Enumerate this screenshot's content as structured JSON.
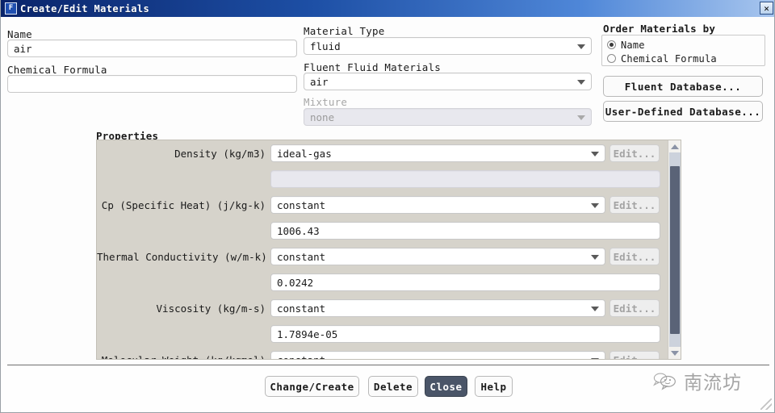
{
  "window": {
    "title": "Create/Edit Materials",
    "icon": "fluent-f-icon",
    "icon_letter": "F",
    "close_glyph": "✕"
  },
  "left": {
    "name_label": "Name",
    "name_value": "air",
    "chemical_formula_label": "Chemical Formula",
    "chemical_formula_value": ""
  },
  "middle": {
    "material_type_label": "Material Type",
    "material_type_value": "fluid",
    "fluent_fluid_materials_label": "Fluent Fluid Materials",
    "fluent_fluid_materials_value": "air",
    "mixture_label": "Mixture",
    "mixture_value": "none"
  },
  "right": {
    "order_label": "Order Materials by",
    "radio_name": "Name",
    "radio_chemical_formula": "Chemical Formula",
    "fluent_database_button": "Fluent Database...",
    "user_defined_database_button": "User-Defined Database..."
  },
  "properties": {
    "label": "Properties",
    "edit_label": "Edit...",
    "rows": [
      {
        "label": "Density (kg/m3)",
        "method": "ideal-gas",
        "value": "",
        "value_disabled": true
      },
      {
        "label": "Cp (Specific Heat) (j/kg-k)",
        "method": "constant",
        "value": "1006.43",
        "value_disabled": false
      },
      {
        "label": "Thermal Conductivity (w/m-k)",
        "method": "constant",
        "value": "0.0242",
        "value_disabled": false
      },
      {
        "label": "Viscosity (kg/m-s)",
        "method": "constant",
        "value": "1.7894e-05",
        "value_disabled": false
      },
      {
        "label": "Molecular Weight (kg/kgmol)",
        "method": "constant",
        "value": "",
        "value_disabled": false
      }
    ]
  },
  "footer": {
    "change_create": "Change/Create",
    "delete": "Delete",
    "close": "Close",
    "help": "Help"
  },
  "watermark": {
    "text": "南流坊",
    "icon": "chat-bubbles-icon"
  },
  "colors": {
    "titlebar_start": "#0a246a",
    "titlebar_end": "#a8c6ee",
    "properties_panel": "#d6d3cb",
    "close_button": "#4a5568",
    "scroll_thumb": "#5a6377"
  }
}
